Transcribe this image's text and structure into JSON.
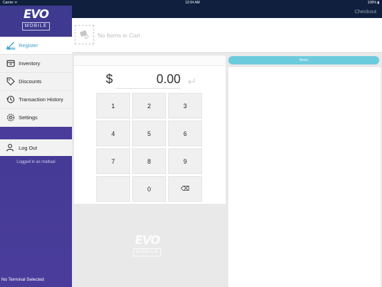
{
  "status": {
    "carrier": "Carrier ᯤ",
    "time": "12:04 AM",
    "battery": "100% ▮"
  },
  "brand": {
    "mark": "EVO",
    "sub": "MOBILE"
  },
  "menu": [
    {
      "label": "Register",
      "icon": "register-icon",
      "active": true
    },
    {
      "label": "Inventory",
      "icon": "inventory-icon",
      "active": false
    },
    {
      "label": "Discounts",
      "icon": "discounts-icon",
      "active": false
    },
    {
      "label": "Transaction History",
      "icon": "history-icon",
      "active": false
    },
    {
      "label": "Settings",
      "icon": "settings-icon",
      "active": false
    }
  ],
  "logout": {
    "label": "Log Out"
  },
  "logged_in": "Logged in as mattual",
  "terminal": "No Terminal Selected",
  "topbar": {
    "checkout": "Checkout"
  },
  "cart": {
    "empty_text": "No Items in Cart"
  },
  "amount": {
    "currency": "$",
    "value": "0.00",
    "enter_glyph": "↵"
  },
  "keypad": [
    "1",
    "2",
    "3",
    "4",
    "5",
    "6",
    "7",
    "8",
    "9",
    "",
    "0",
    "⌫"
  ],
  "right": {
    "items_button": "Items"
  },
  "colors": {
    "sidebar": "#4a3c9b",
    "accent": "#3a9fc8",
    "topbar": "#0f1f3d",
    "items_button": "#6ccbdc"
  }
}
